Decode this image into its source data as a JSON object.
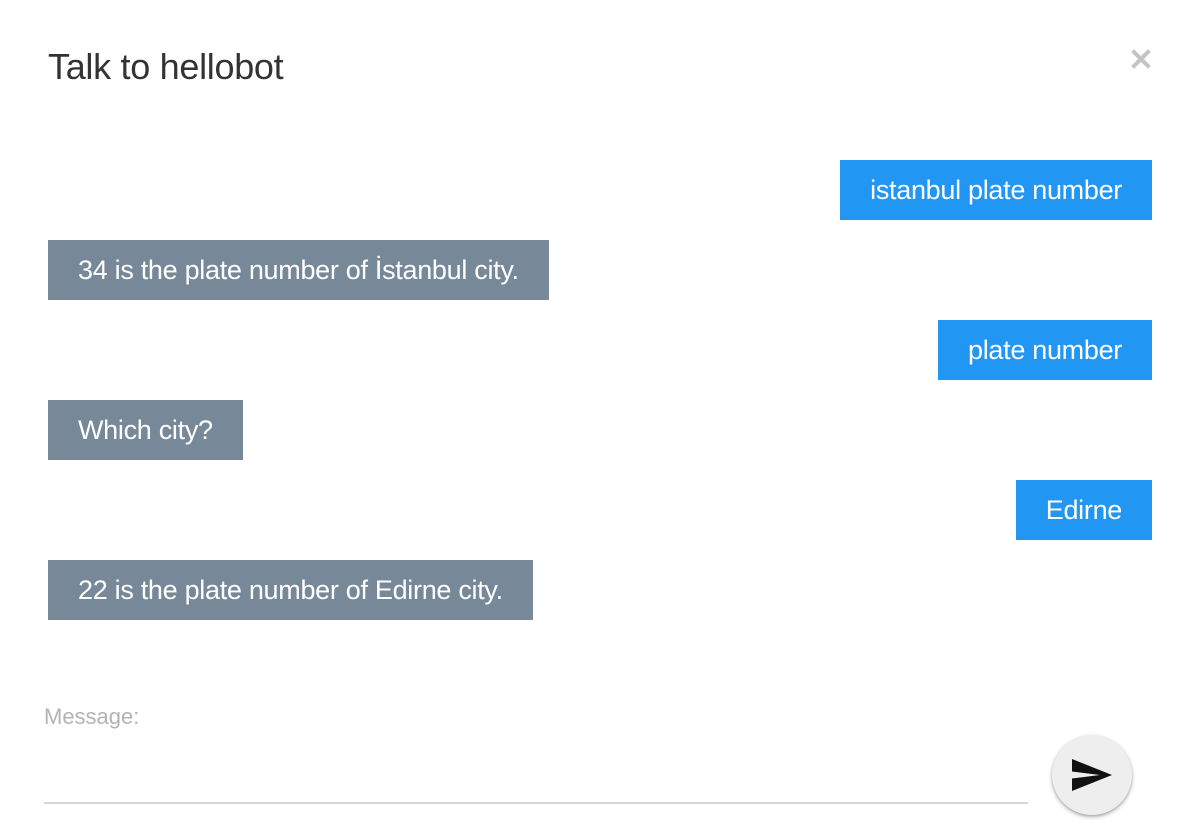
{
  "dialog": {
    "title": "Talk to hellobot",
    "close_icon": "close-icon"
  },
  "colors": {
    "user_bubble": "#2196f3",
    "bot_bubble": "#778899",
    "title_text": "#333333",
    "label_text": "#b3b3b3"
  },
  "messages": [
    {
      "sender": "user",
      "text": "istanbul plate number"
    },
    {
      "sender": "bot",
      "text": "34 is the plate number of İstanbul city."
    },
    {
      "sender": "user",
      "text": "plate number"
    },
    {
      "sender": "bot",
      "text": "Which city?"
    },
    {
      "sender": "user",
      "text": "Edirne"
    },
    {
      "sender": "bot",
      "text": "22 is the plate number of Edirne city."
    }
  ],
  "composer": {
    "label": "Message:",
    "value": "",
    "send_icon": "send-icon"
  }
}
